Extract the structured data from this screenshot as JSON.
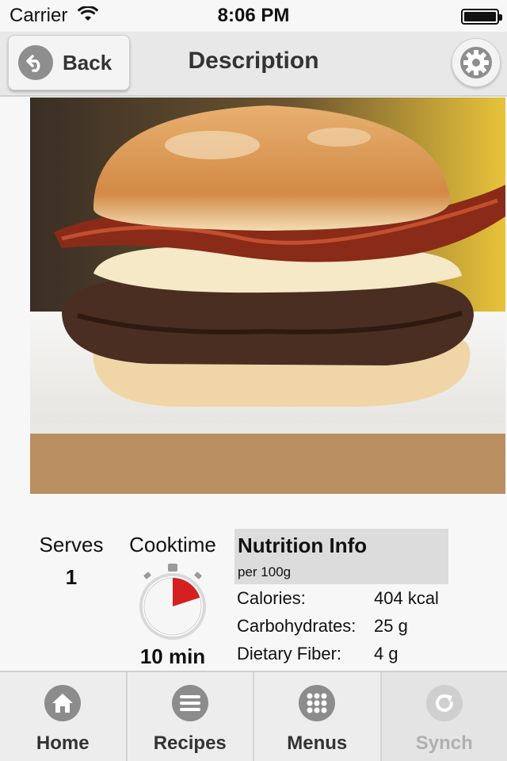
{
  "status_bar": {
    "carrier": "Carrier",
    "time": "8:06 PM"
  },
  "nav": {
    "back_label": "Back",
    "title": "Description"
  },
  "recipe": {
    "serves_label": "Serves",
    "serves_value": "1",
    "cooktime_label": "Cooktime",
    "cooktime_value": "10 min"
  },
  "nutrition": {
    "title": "Nutrition Info",
    "subtitle": "per 100g",
    "rows": [
      {
        "label": "Calories:",
        "value": "404 kcal"
      },
      {
        "label": "Carbohydrates:",
        "value": "25 g"
      },
      {
        "label": "Dietary Fiber:",
        "value": "4 g"
      }
    ]
  },
  "tabs": [
    {
      "label": "Home",
      "icon": "home-icon"
    },
    {
      "label": "Recipes",
      "icon": "list-icon"
    },
    {
      "label": "Menus",
      "icon": "grid-icon"
    },
    {
      "label": "Synch",
      "icon": "sync-icon",
      "disabled": true
    }
  ],
  "colors": {
    "accent_red": "#d42020",
    "icon_gray": "#8c8c8c",
    "disabled_gray": "#b0b0b0"
  }
}
